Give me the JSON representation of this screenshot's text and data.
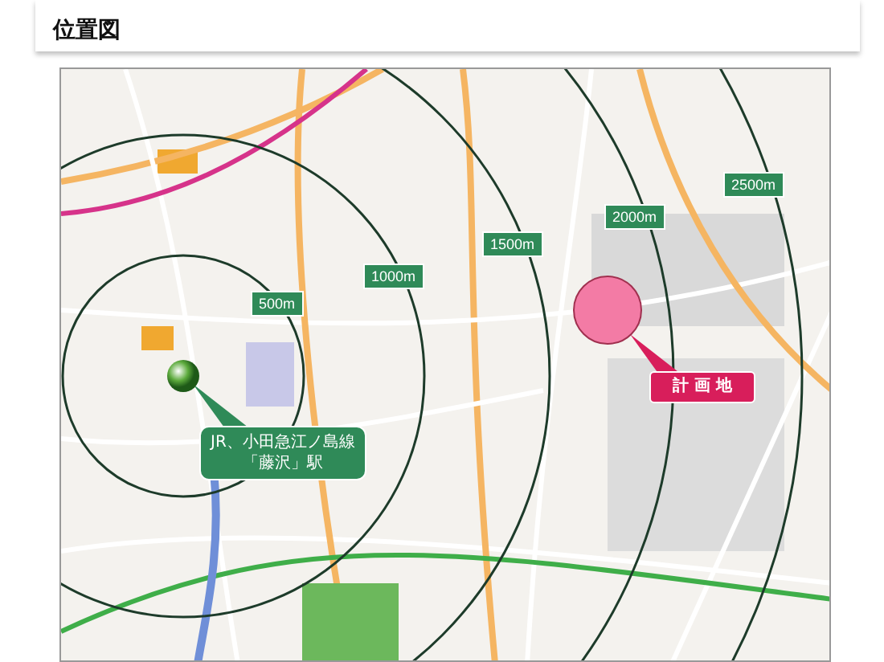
{
  "header": {
    "title": "位置図"
  },
  "map": {
    "rings": [
      {
        "label": "500m"
      },
      {
        "label": "1000m"
      },
      {
        "label": "1500m"
      },
      {
        "label": "2000m"
      },
      {
        "label": "2500m"
      }
    ],
    "station": {
      "lines": [
        "JR、小田急江ノ島線",
        "「藤沢」駅"
      ]
    },
    "site": {
      "label": "計 画 地"
    }
  }
}
